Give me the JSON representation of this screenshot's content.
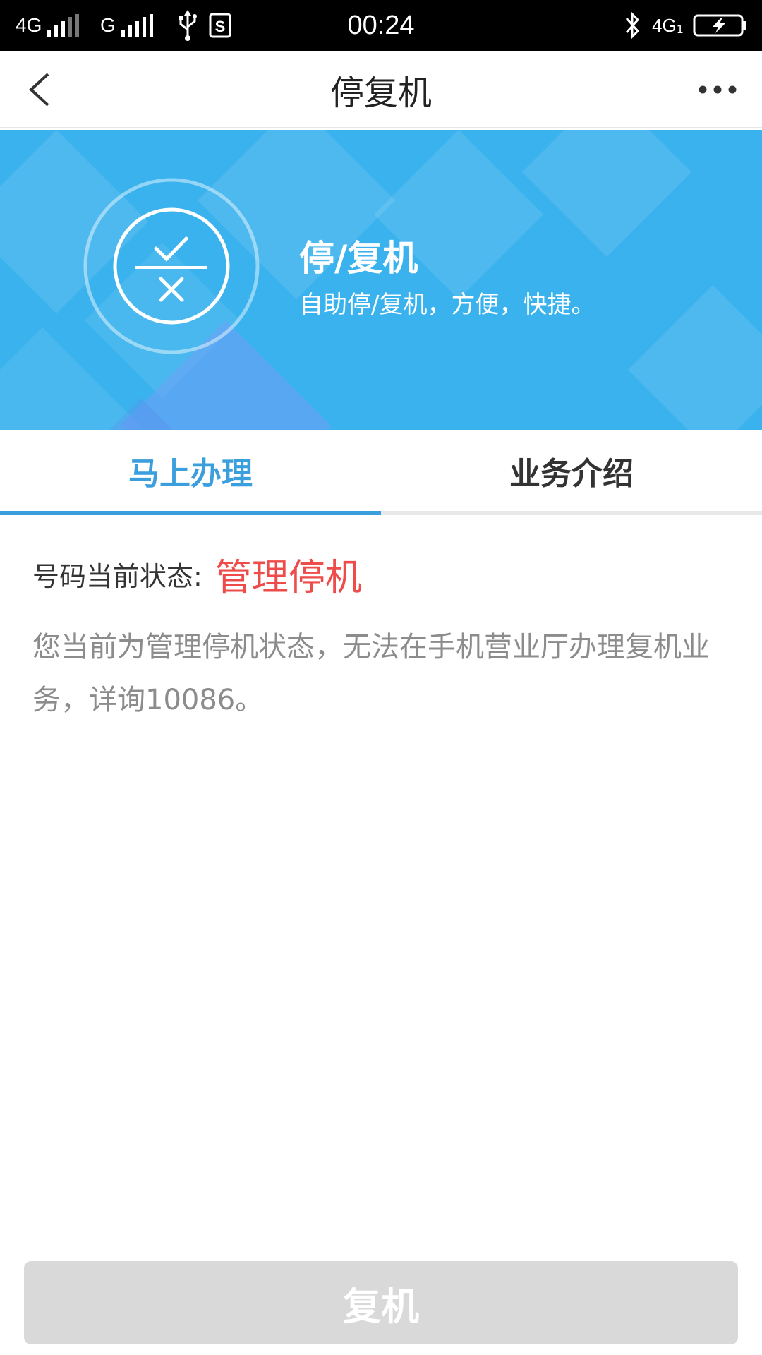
{
  "status_bar": {
    "network_1": "4G",
    "network_2": "G",
    "time": "00:24",
    "network_3": "4G",
    "sim_slot": "1",
    "icons": [
      "signal-icon",
      "usb-icon",
      "sim-icon",
      "bluetooth-icon",
      "battery-charging-icon"
    ]
  },
  "header": {
    "title": "停复机",
    "back_icon": "chevron-left-icon",
    "more_icon": "more-dots-icon"
  },
  "banner": {
    "title": "停/复机",
    "subtitle": "自助停/复机，方便，快捷。",
    "icon": "check-cross-icon",
    "color": "#3ab2ee"
  },
  "tabs": [
    {
      "label": "马上办理",
      "active": true
    },
    {
      "label": "业务介绍",
      "active": false
    }
  ],
  "content": {
    "status_label": "号码当前状态:",
    "status_value": "管理停机",
    "notice": "您当前为管理停机状态，无法在手机营业厅办理复机业务，详询10086。"
  },
  "bottom": {
    "button_label": "复机",
    "enabled": false
  },
  "colors": {
    "accent": "#3a9fdc",
    "status_red": "#ee4b4b",
    "disabled_button": "#d9d9d9"
  }
}
